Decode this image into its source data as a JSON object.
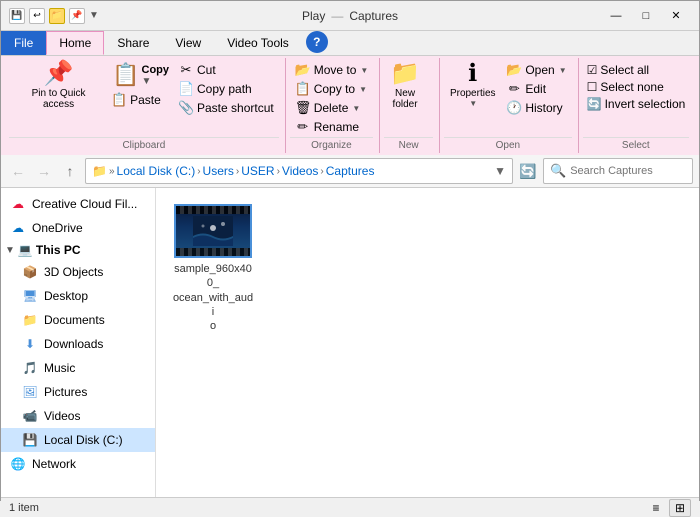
{
  "titleBar": {
    "title": "Captures",
    "minimizeLabel": "—",
    "maximizeLabel": "□",
    "closeLabel": "✕"
  },
  "tabs": {
    "play": "Play",
    "title": "Captures"
  },
  "ribbon": {
    "tabs": [
      "File",
      "Home",
      "Share",
      "View",
      "Video Tools"
    ],
    "activeTab": "Home",
    "groups": {
      "clipboard": {
        "label": "Clipboard",
        "pinToQuick": "Pin to Quick\naccess",
        "copy": "Copy",
        "paste": "Paste",
        "cut": "Cut",
        "copyPath": "Copy path",
        "pasteShortcut": "Paste shortcut"
      },
      "organize": {
        "label": "Organize",
        "moveTo": "Move to",
        "copyTo": "Copy to",
        "delete": "Delete",
        "rename": "Rename"
      },
      "new": {
        "label": "New",
        "newFolder": "New\nfolder"
      },
      "open": {
        "label": "Open",
        "open": "Open",
        "edit": "Edit",
        "history": "History",
        "properties": "Properties"
      },
      "select": {
        "label": "Select",
        "selectAll": "Select all",
        "selectNone": "Select none",
        "invertSelection": "Invert selection"
      }
    }
  },
  "addressBar": {
    "breadcrumbs": [
      "Local Disk (C:)",
      "Users",
      "USER",
      "Videos",
      "Captures"
    ],
    "searchPlaceholder": "Search Captures"
  },
  "sidebar": {
    "items": [
      {
        "label": "Creative Cloud Fil...",
        "icon": "☁",
        "color": "#e8173e"
      },
      {
        "label": "OneDrive",
        "icon": "☁",
        "color": "#0072c6"
      },
      {
        "label": "This PC",
        "icon": "💻",
        "isSection": true
      },
      {
        "label": "3D Objects",
        "icon": "📦",
        "color": "#4a90d9",
        "indent": true
      },
      {
        "label": "Desktop",
        "icon": "🖥",
        "color": "#4a90d9",
        "indent": true
      },
      {
        "label": "Documents",
        "icon": "📁",
        "color": "#4a90d9",
        "indent": true
      },
      {
        "label": "Downloads",
        "icon": "⬇",
        "color": "#4a90d9",
        "indent": true
      },
      {
        "label": "Music",
        "icon": "🎵",
        "color": "#4a90d9",
        "indent": true
      },
      {
        "label": "Pictures",
        "icon": "🖼",
        "color": "#4a90d9",
        "indent": true
      },
      {
        "label": "Videos",
        "icon": "📹",
        "color": "#4a90d9",
        "indent": true
      },
      {
        "label": "Local Disk (C:)",
        "icon": "💾",
        "color": "#4a90d9",
        "indent": true,
        "selected": true
      },
      {
        "label": "Network",
        "icon": "🌐",
        "color": "#4a90d9"
      }
    ]
  },
  "fileArea": {
    "items": [
      {
        "name": "sample_960x400_\nocean_with_audi\no",
        "type": "video"
      }
    ]
  },
  "statusBar": {
    "itemCount": "1 item",
    "views": [
      "list",
      "detail",
      "tile",
      "icon"
    ]
  }
}
